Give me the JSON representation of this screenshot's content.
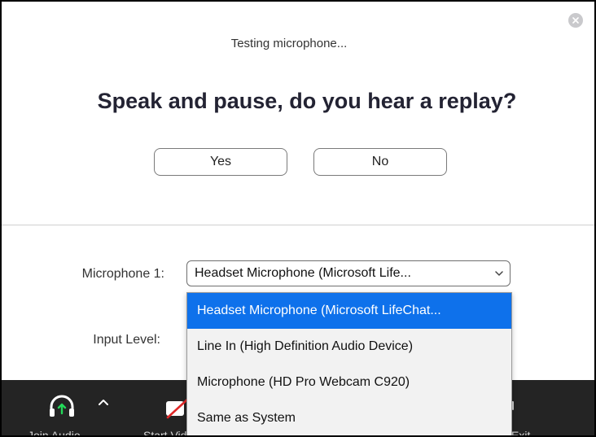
{
  "dialog": {
    "status_text": "Testing microphone...",
    "question": "Speak and pause, do you hear a replay?",
    "yes_label": "Yes",
    "no_label": "No",
    "close_icon": "close-icon"
  },
  "settings": {
    "microphone_label": "Microphone 1:",
    "input_level_label": "Input Level:",
    "selected_device": "Headset Microphone (Microsoft Life...",
    "dropdown_options": [
      "Headset Microphone (Microsoft LifeChat...",
      "Line In (High Definition Audio Device)",
      "Microphone (HD Pro Webcam C920)",
      "Same as System"
    ],
    "selected_index": 0
  },
  "toolbar": {
    "audio_label": "Join Audio",
    "video_label": "Start Video",
    "right_label": "Exit",
    "icons": [
      "headphone-icon",
      "caret-up-icon",
      "video-off-icon"
    ]
  },
  "colors": {
    "accent": "#0e71eb",
    "toolbar_bg": "#242424",
    "headphone_arrow": "#23d959"
  }
}
